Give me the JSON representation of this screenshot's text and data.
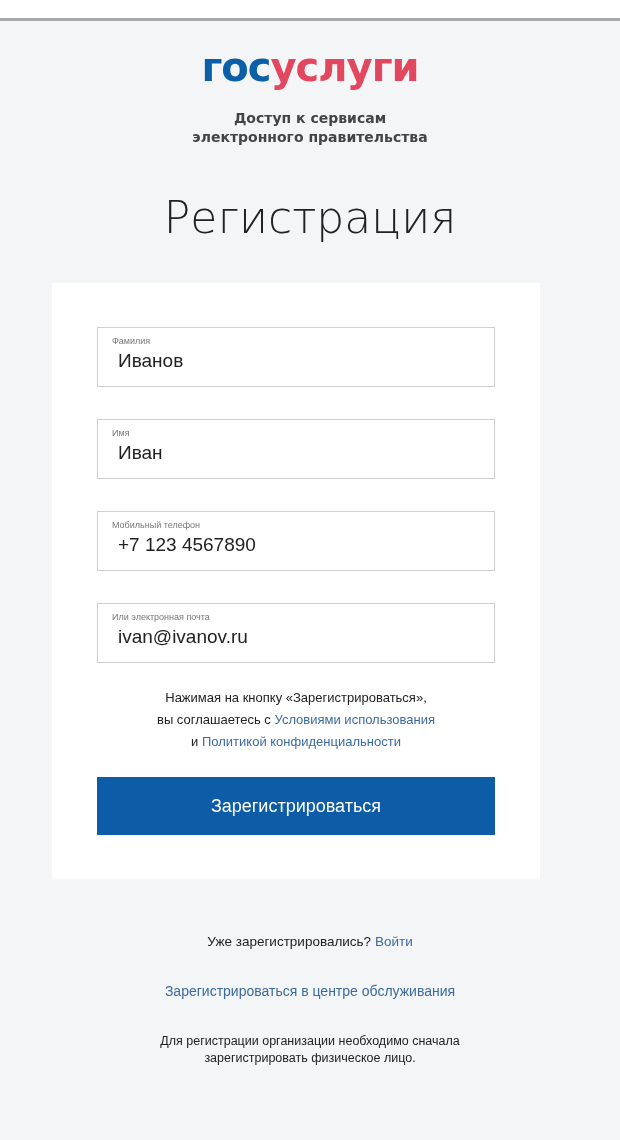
{
  "logo": {
    "first": "гос",
    "second": "услуги"
  },
  "tagline": [
    "Доступ к сервисам",
    "электронного правительства"
  ],
  "title": "Регистрация",
  "fields": [
    {
      "label": "Фамилия",
      "value": "Иванов"
    },
    {
      "label": "Имя",
      "value": "Иван"
    },
    {
      "label": "Мобильный телефон",
      "value": "+7 123 4567890"
    },
    {
      "label": "Или электронная почта",
      "value": "ivan@ivanov.ru"
    }
  ],
  "terms": {
    "text_1": "Нажимая на кнопку «Зарегистрироваться»,",
    "text_2": "вы соглашаетесь с",
    "link_1": "Условиями использования",
    "text_3": "и",
    "link_2": "Политикой конфиденциальности"
  },
  "submit": "Зарегистрироваться",
  "login": {
    "text": "Уже зарегистрировались?",
    "link": "Войти"
  },
  "service_center_link": "Зарегистрироваться в центре обслуживания",
  "note": "Для регистрации организации необходимо сначала зарегистрировать физическое лицо."
}
